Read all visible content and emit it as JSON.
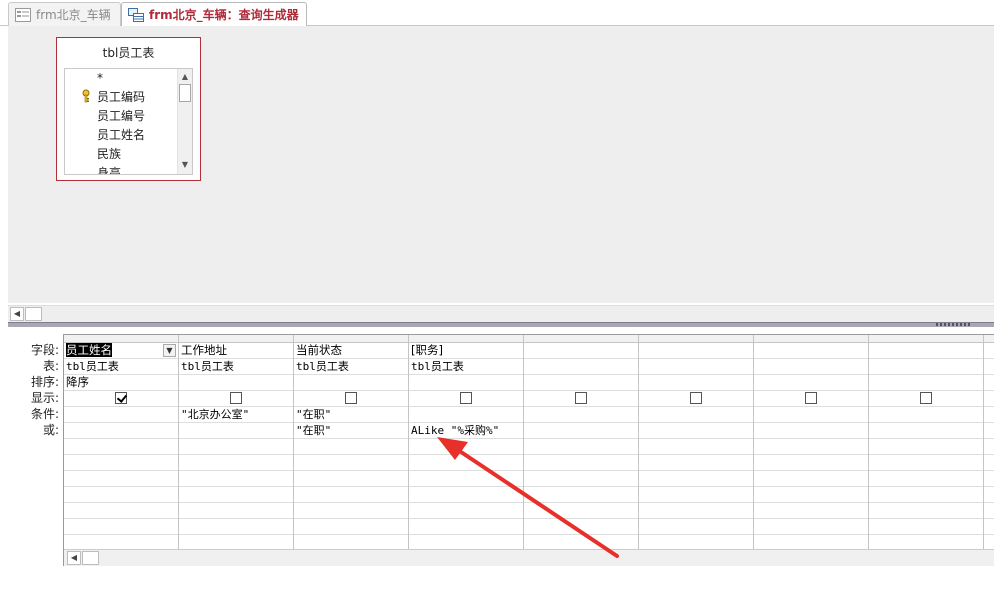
{
  "tabs": [
    {
      "label": "frm北京_车辆",
      "active": false,
      "icon": "form-icon"
    },
    {
      "label": "frm北京_车辆：查询生成器",
      "active": true,
      "icon": "query-designer-icon"
    }
  ],
  "field_table": {
    "title": "tbl员工表",
    "fields": [
      {
        "name": "*",
        "primary_key": false
      },
      {
        "name": "员工编码",
        "primary_key": true
      },
      {
        "name": "员工编号",
        "primary_key": false
      },
      {
        "name": "员工姓名",
        "primary_key": false
      },
      {
        "name": "民族",
        "primary_key": false
      },
      {
        "name": "身高",
        "primary_key": false
      }
    ]
  },
  "grid": {
    "row_labels": [
      "字段:",
      "表:",
      "排序:",
      "显示:",
      "条件:",
      "或:"
    ],
    "columns": [
      {
        "field": "员工姓名",
        "table": "tbl员工表",
        "sort": "降序",
        "show": true,
        "criteria": "",
        "or": "",
        "selected": true
      },
      {
        "field": "工作地址",
        "table": "tbl员工表",
        "sort": "",
        "show": false,
        "criteria": "\"北京办公室\"",
        "or": ""
      },
      {
        "field": "当前状态",
        "table": "tbl员工表",
        "sort": "",
        "show": false,
        "criteria": "\"在职\"",
        "or": "\"在职\""
      },
      {
        "field": "[职务]",
        "table": "tbl员工表",
        "sort": "",
        "show": false,
        "criteria": "",
        "or": "ALike \"%采购%\""
      },
      {
        "field": "",
        "table": "",
        "sort": "",
        "show": false,
        "criteria": "",
        "or": ""
      },
      {
        "field": "",
        "table": "",
        "sort": "",
        "show": false,
        "criteria": "",
        "or": ""
      },
      {
        "field": "",
        "table": "",
        "sort": "",
        "show": false,
        "criteria": "",
        "or": ""
      },
      {
        "field": "",
        "table": "",
        "sort": "",
        "show": false,
        "criteria": "",
        "or": ""
      },
      {
        "field": "",
        "table": "",
        "sort": "",
        "show": false,
        "criteria": "",
        "or": ""
      }
    ]
  },
  "colors": {
    "accent": "#b02a37",
    "annotation_arrow": "#e8302a"
  }
}
